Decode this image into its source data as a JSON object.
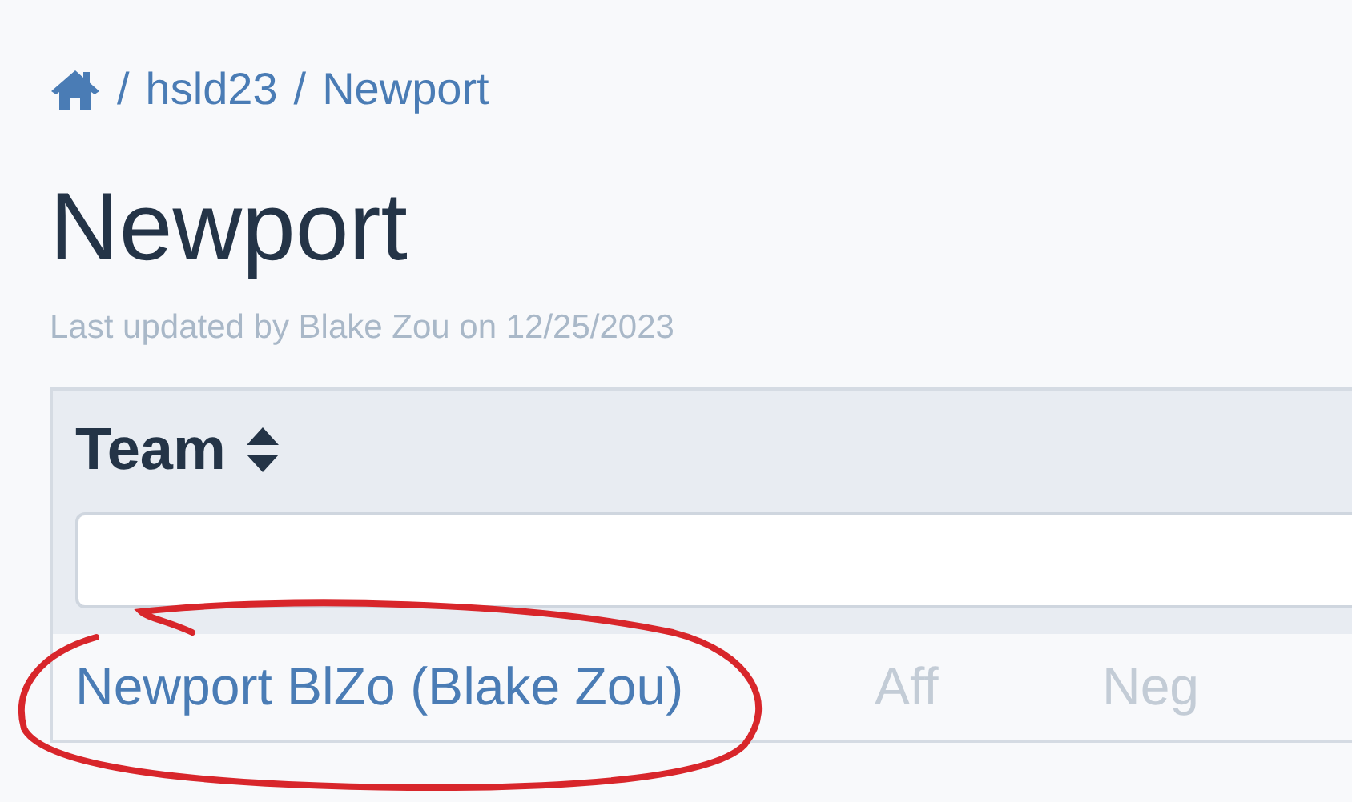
{
  "breadcrumb": [
    {
      "kind": "home"
    },
    {
      "kind": "separator",
      "text": "/"
    },
    {
      "kind": "link",
      "text": "hsld23"
    },
    {
      "kind": "separator",
      "text": "/"
    },
    {
      "kind": "link",
      "text": "Newport"
    }
  ],
  "page": {
    "title": "Newport",
    "updated": "Last updated by Blake Zou on 12/25/2023"
  },
  "table": {
    "columns": [
      {
        "label": "Team",
        "sortable": true
      }
    ],
    "rows": [
      {
        "team": "Newport BlZo (Blake Zou)",
        "column_2": "Aff",
        "column_3": "Neg",
        "disabled": true
      }
    ]
  },
  "annotations": [
    {
      "kind": "hand-drawn-circle"
    }
  ]
}
